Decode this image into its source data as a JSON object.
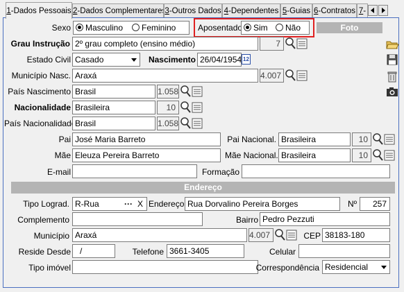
{
  "tabs": [
    {
      "num": "1",
      "label": "-Dados Pessoais"
    },
    {
      "num": "2",
      "label": "-Dados Complementares"
    },
    {
      "num": "3",
      "label": "-Outros Dados"
    },
    {
      "num": "4",
      "label": "-Dependentes"
    },
    {
      "num": "5",
      "label": "-Guias"
    },
    {
      "num": "6",
      "label": "-Contratos"
    },
    {
      "num": "7",
      "label": "-"
    }
  ],
  "form": {
    "sexo_label": "Sexo",
    "sexo_masc": "Masculino",
    "sexo_fem": "Feminino",
    "sexo_value": "Masculino",
    "aposentado_label": "Aposentado",
    "aposentado_sim": "Sim",
    "aposentado_nao": "Não",
    "aposentado_value": "Sim",
    "foto_label": "Foto",
    "grau_label": "Grau Instrução",
    "grau_value": "2º grau completo (ensino médio)",
    "grau_code": "7",
    "estado_civil_label": "Estado Civil",
    "estado_civil_value": "Casado",
    "nascimento_label": "Nascimento",
    "nascimento_value": "26/04/1954",
    "calendar_day": "12",
    "municipio_nasc_label": "Município Nasc.",
    "municipio_nasc_value": "Araxá",
    "municipio_nasc_code": "4.007",
    "pais_nasc_label": "País Nascimento",
    "pais_nasc_value": "Brasil",
    "pais_nasc_code": "1.058",
    "nacionalidade_label": "Nacionalidade",
    "nacionalidade_value": "Brasileira",
    "nacionalidade_code": "10",
    "pais_nacionalidade_label": "País Nacionalidade",
    "pais_nacionalidade_value": "Brasil",
    "pais_nacionalidade_code": "1.058",
    "pai_label": "Pai",
    "pai_value": "José Maria Barreto",
    "pai_nac_label": "Pai Nacional.",
    "pai_nac_value": "Brasileira",
    "pai_nac_code": "10",
    "mae_label": "Mãe",
    "mae_value": "Eleuza Pereira Barreto",
    "mae_nac_label": "Mãe Nacional.",
    "mae_nac_value": "Brasileira",
    "mae_nac_code": "10",
    "email_label": "E-mail",
    "email_value": "",
    "formacao_label": "Formação",
    "formacao_value": ""
  },
  "endereco": {
    "section_title": "Endereço",
    "tipo_lograd_label": "Tipo Lograd.",
    "tipo_lograd_value": "R-Rua",
    "tipo_lograd_dots": "···",
    "tipo_lograd_clear": "X",
    "endereco_label": "Endereço",
    "endereco_value": "Rua Dorvalino Pereira Borges",
    "numero_label": "Nº",
    "numero_value": "257",
    "complemento_label": "Complemento",
    "complemento_value": "",
    "bairro_label": "Bairro",
    "bairro_value": "Pedro Pezzuti",
    "municipio_label": "Município",
    "municipio_value": "Araxá",
    "municipio_code": "4.007",
    "cep_label": "CEP",
    "cep_value": "38183-180",
    "reside_label": "Reside Desde",
    "reside_value": "/",
    "telefone_label": "Telefone",
    "telefone_value": "3661-3405",
    "celular_label": "Celular",
    "celular_value": "",
    "tipo_imovel_label": "Tipo imóvel",
    "tipo_imovel_value": "",
    "correspondencia_label": "Correspondência",
    "correspondencia_value": "Residencial"
  },
  "icons": {
    "lookup": "magnifier-list-icon",
    "folder": "folder-open-icon",
    "save": "floppy-save-icon",
    "trash": "trash-icon",
    "camera": "camera-icon"
  },
  "colors": {
    "highlight_border": "#e02020",
    "panel_border": "#4a6fc0",
    "section_bg": "#b4b4b4"
  }
}
